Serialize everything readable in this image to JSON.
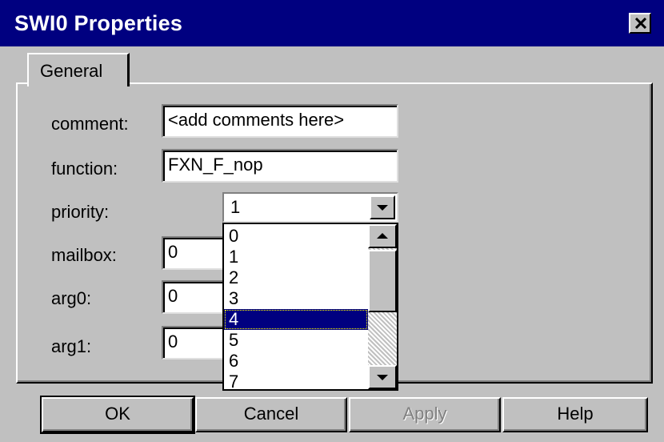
{
  "window": {
    "title": "SWI0 Properties",
    "close_icon": "close-icon"
  },
  "tabs": [
    {
      "label": "General",
      "active": true
    }
  ],
  "form": {
    "comment": {
      "label": "comment:",
      "value": "<add comments here>"
    },
    "function": {
      "label": "function:",
      "value": "FXN_F_nop"
    },
    "priority": {
      "label": "priority:",
      "value": "1",
      "options_visible": [
        "0",
        "1",
        "2",
        "3",
        "4",
        "5",
        "6",
        "7"
      ],
      "highlighted": "4"
    },
    "mailbox": {
      "label": "mailbox:",
      "value": "0"
    },
    "arg0": {
      "label": "arg0:",
      "value": "0"
    },
    "arg1": {
      "label": "arg1:",
      "value": "0"
    }
  },
  "buttons": {
    "ok": "OK",
    "cancel": "Cancel",
    "apply": "Apply",
    "help": "Help"
  },
  "colors": {
    "titlebar": "#000080",
    "face": "#c0c0c0",
    "selection": "#000080"
  }
}
